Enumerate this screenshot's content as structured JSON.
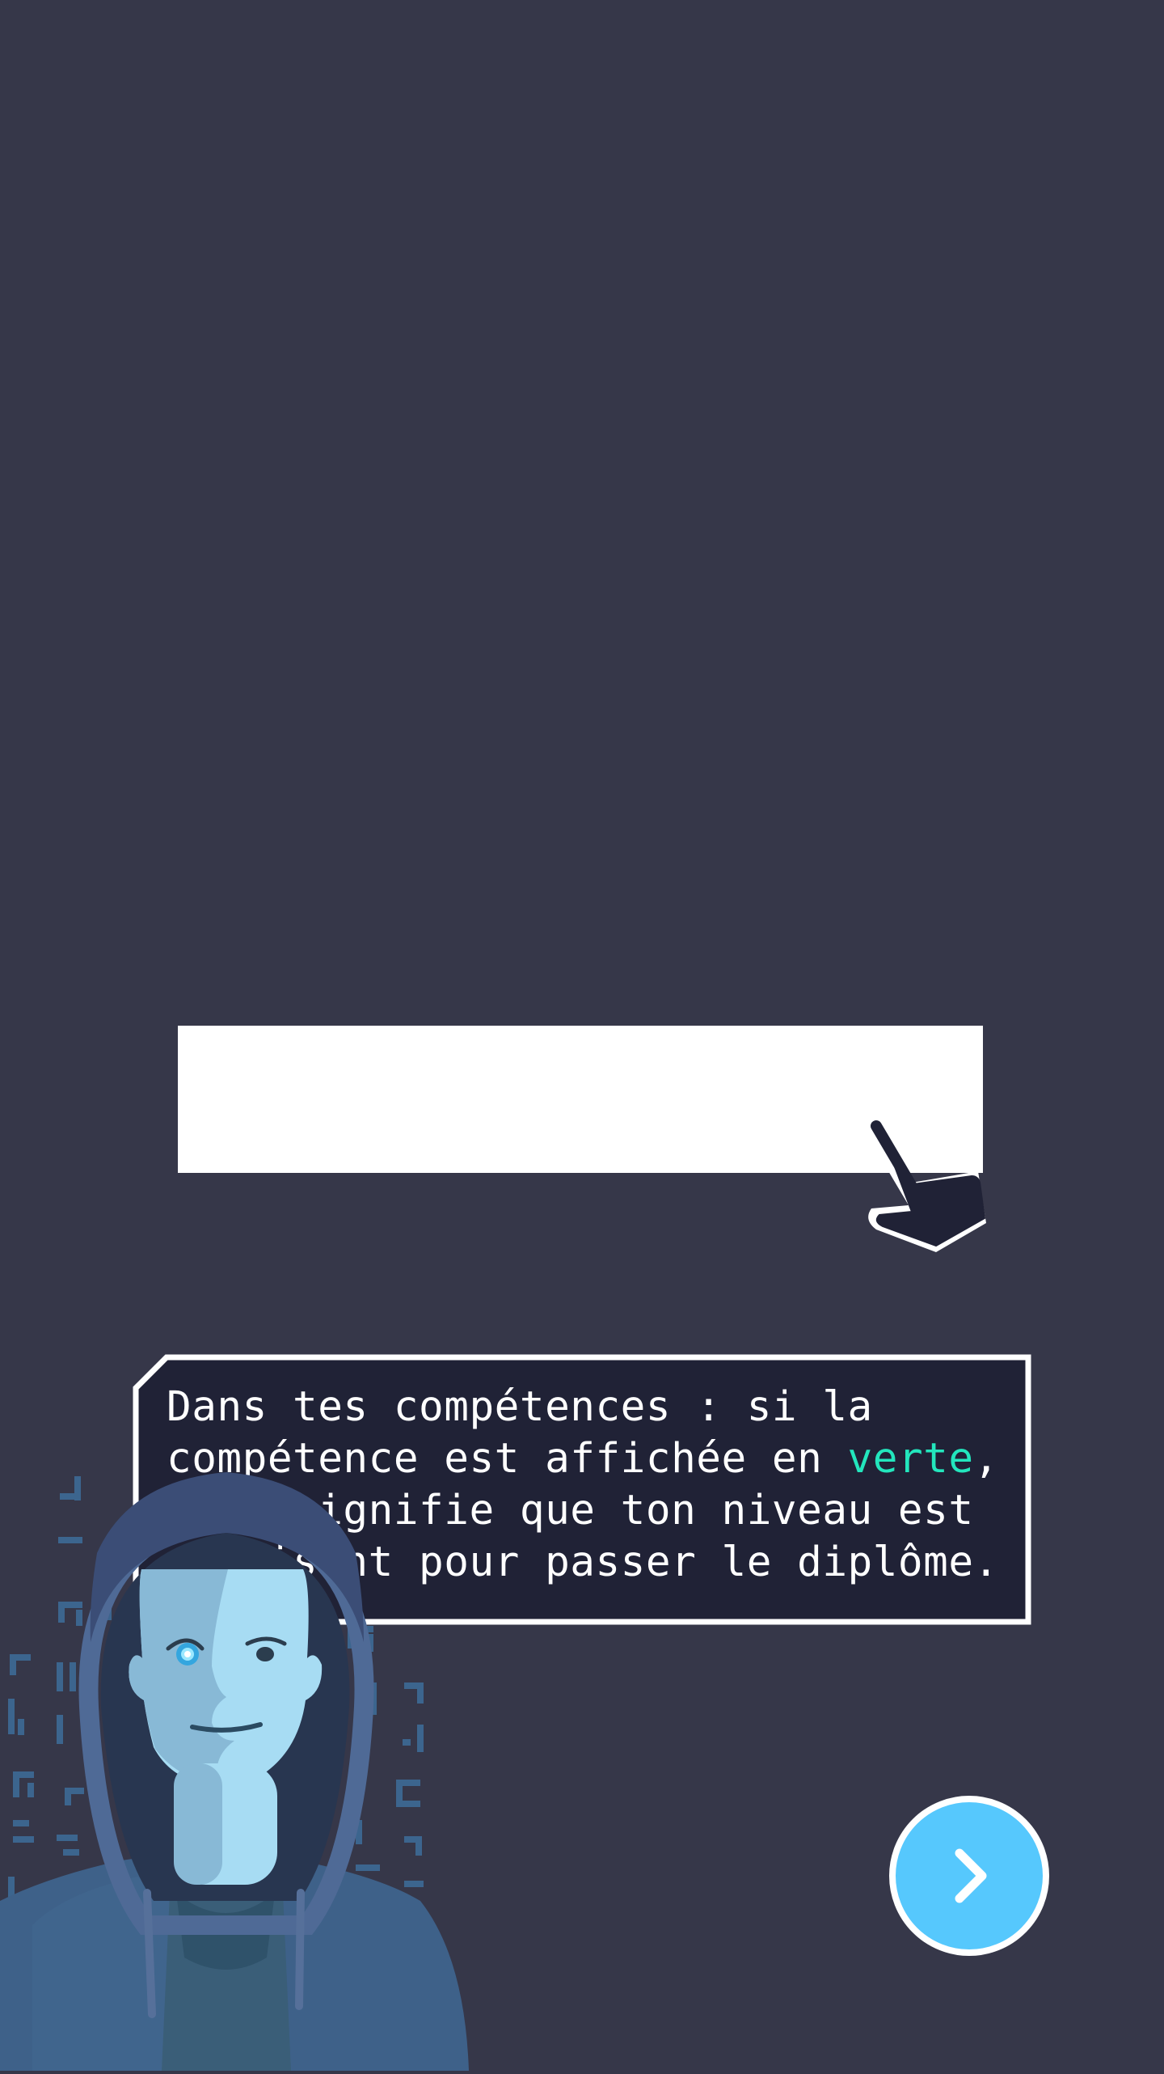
{
  "colors": {
    "background": "#363749",
    "accent": "#23e6bd",
    "bubble_bg": "#202236",
    "next_button": "#56c8fd"
  },
  "highlight_area": {
    "label": ""
  },
  "dialog": {
    "text_before": "Dans tes compétences : si la\ncompétence est affichée en ",
    "highlight": "verte",
    "text_after": ",\ncela signifie que ton niveau est\nsuffisant pour passer le diplôme."
  },
  "icons": {
    "pointer": "hand-pointer-icon",
    "next": "chevron-right-icon",
    "avatar": "hooded-character-avatar"
  }
}
